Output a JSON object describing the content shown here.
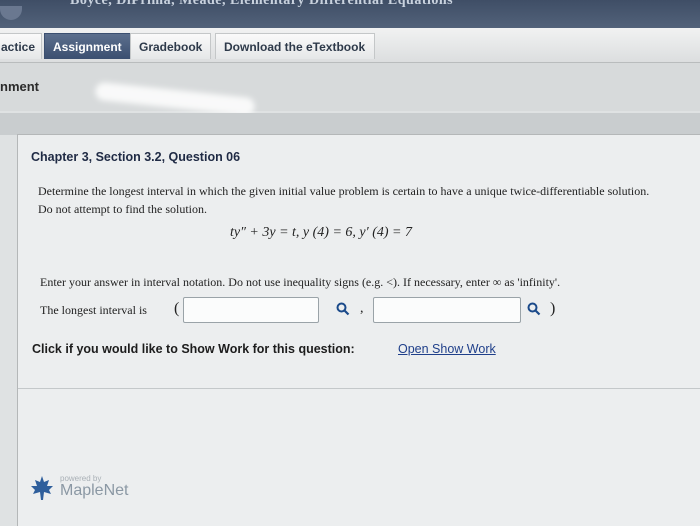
{
  "title_strip": {
    "text": "Boyce, DiPrima, Meade, Elementary Differential Equations"
  },
  "nav": {
    "tabs": [
      {
        "label": "actice"
      },
      {
        "label": "Assignment",
        "active": true
      },
      {
        "label": "Gradebook"
      },
      {
        "label": "Download the eTextbook"
      }
    ]
  },
  "assignment": {
    "title": "nment"
  },
  "question": {
    "heading": "Chapter 3, Section 3.2, Question 06",
    "prompt": "Determine the longest interval in which the given initial value problem is certain to have a unique twice-differentiable solution. Do not attempt to find the solution.",
    "equation": "ty″ + 3y = t, y (4) = 6, y′ (4) = 7",
    "instructions": "Enter your answer in interval notation. Do not use inequality signs (e.g. <). If necessary, enter ∞ as 'infinity'.",
    "answer_label": "The longest interval is",
    "open_paren": "(",
    "separator": ",",
    "close_paren": ")",
    "lower_bound": {
      "value": "",
      "placeholder": ""
    },
    "upper_bound": {
      "value": "",
      "placeholder": ""
    }
  },
  "show_work": {
    "prompt": "Click if you would like to Show Work for this question:",
    "link": "Open Show Work"
  },
  "footer": {
    "powered": "powered by",
    "brand": "MapleNet"
  },
  "colors": {
    "accent": "#3b4f70",
    "link": "#1f3f8a",
    "heading": "#1f2a44"
  },
  "icons": [
    "magnifier-icon",
    "maple-leaf-icon"
  ]
}
